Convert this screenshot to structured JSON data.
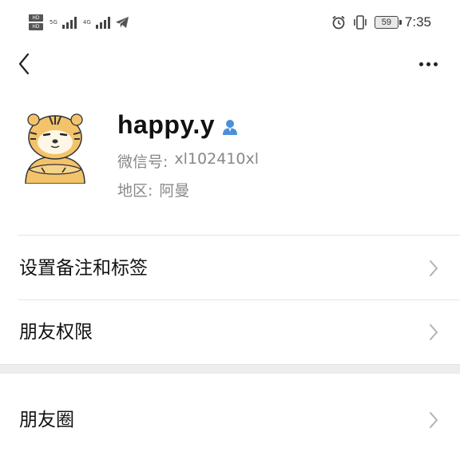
{
  "status_bar": {
    "left_badges": [
      "HD",
      "HD"
    ],
    "network_label": "5G",
    "network_label_2": "4G",
    "battery_level": "59",
    "time": "7:35",
    "icons": [
      "telegram-icon",
      "alarm-icon",
      "vibrate-icon",
      "battery-icon"
    ]
  },
  "nav": {
    "back_icon": "chevron-left-icon",
    "more_icon": "more-dots-icon"
  },
  "profile": {
    "avatar_description": "tiger-avatar",
    "name": "happy.y",
    "gender_icon": "male-person-icon",
    "wechat_id_label": "微信号:",
    "wechat_id_value": "xl102410xl",
    "region_label": "地区:",
    "region_value": "阿曼"
  },
  "list": {
    "items": [
      {
        "label": "设置备注和标签"
      },
      {
        "label": "朋友权限"
      },
      {
        "label": "朋友圈"
      }
    ]
  },
  "colors": {
    "text_primary": "#111111",
    "text_secondary": "#888888",
    "divider": "#e5e5e5",
    "section_gap": "#ededed",
    "chevron": "#b2b2b2",
    "gender_icon": "#4a90d9"
  }
}
